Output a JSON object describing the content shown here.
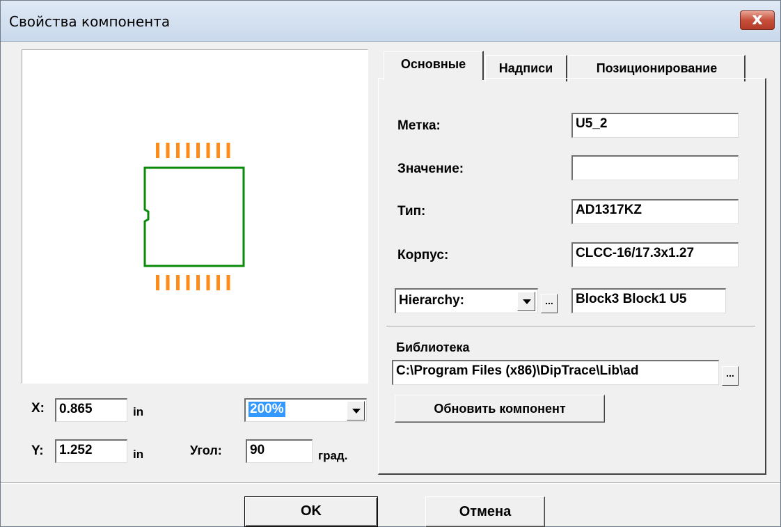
{
  "window": {
    "title": "Свойства компонента",
    "close_icon": "close-icon"
  },
  "preview": {
    "x_label": "X:",
    "x_value": "0.865",
    "x_unit": "in",
    "y_label": "Y:",
    "y_value": "1.252",
    "y_unit": "in",
    "zoom": "200%",
    "angle_label": "Угол:",
    "angle_value": "90",
    "angle_unit": "град.",
    "colors": {
      "pads": "#ff8c1a",
      "outline": "#0a8a0a"
    }
  },
  "tabs": [
    {
      "label": "Основные",
      "active": true
    },
    {
      "label": "Надписи",
      "active": false
    },
    {
      "label": "Позиционирование",
      "active": false
    }
  ],
  "fields": {
    "label_label": "Метка:",
    "label_value": "U5_2",
    "value_label": "Значение:",
    "value_value": "",
    "type_label": "Тип:",
    "type_value": "AD1317KZ",
    "package_label": "Корпус:",
    "package_value": "CLCC-16/17.3x1.27",
    "hierarchy_select": "Hierarchy:",
    "hierarchy_value": "Block3 Block1 U5",
    "ellipsis": "..."
  },
  "library": {
    "label": "Библиотека",
    "path": "C:\\Program Files (x86)\\DipTrace\\Lib\\ad",
    "ellipsis": "...",
    "update_button": "Обновить компонент"
  },
  "buttons": {
    "ok": "OK",
    "cancel": "Отмена"
  }
}
